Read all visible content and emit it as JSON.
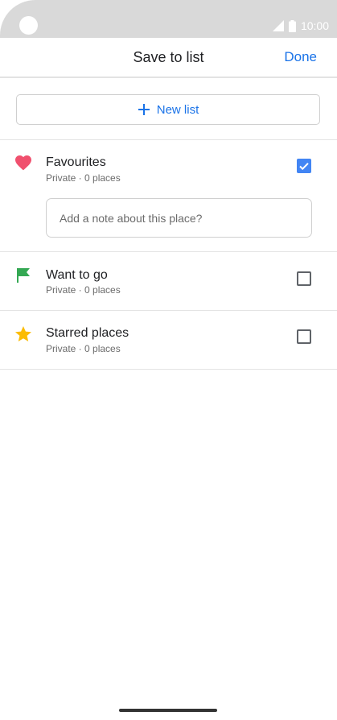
{
  "status_bar": {
    "time": "10:00"
  },
  "header": {
    "title": "Save to list",
    "done_label": "Done"
  },
  "new_list": {
    "label": "New list"
  },
  "lists": [
    {
      "title": "Favourites",
      "subtitle": "Private · 0 places",
      "icon": "heart-icon",
      "checked": true
    },
    {
      "title": "Want to go",
      "subtitle": "Private · 0 places",
      "icon": "flag-icon",
      "checked": false
    },
    {
      "title": "Starred places",
      "subtitle": "Private · 0 places",
      "icon": "star-icon",
      "checked": false
    }
  ],
  "note": {
    "placeholder": "Add a note about this place?"
  },
  "colors": {
    "accent": "#1a73e8",
    "checkbox": "#4285f4",
    "heart": "#f0506e",
    "flag": "#34a853",
    "star": "#fbbc04"
  }
}
